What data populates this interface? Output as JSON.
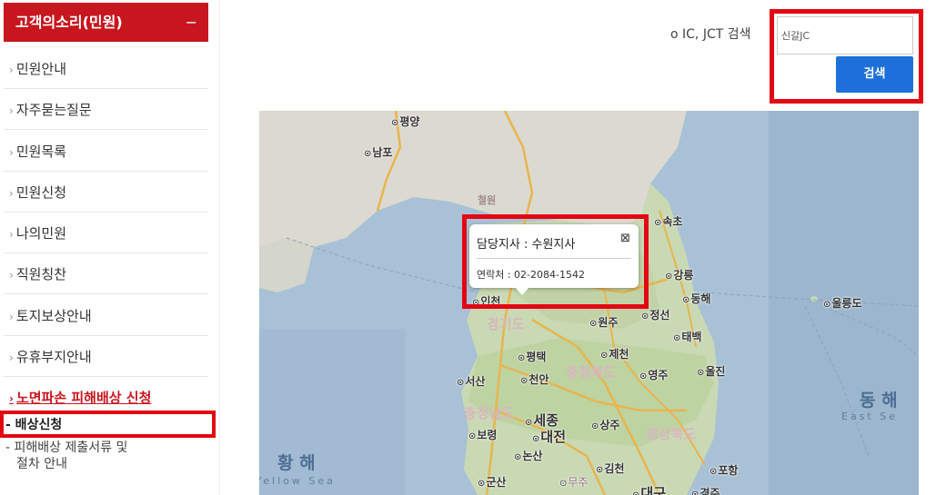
{
  "sidebar": {
    "header": "고객의소리(민원)",
    "header_toggle": "−",
    "arrow": "›",
    "items": [
      {
        "label": "민원안내"
      },
      {
        "label": "자주묻는질문"
      },
      {
        "label": "민원목록"
      },
      {
        "label": "민원신청"
      },
      {
        "label": "나의민원"
      },
      {
        "label": "직원칭찬"
      },
      {
        "label": "토지보상안내"
      },
      {
        "label": "유휴부지안내"
      },
      {
        "label": "노면파손 피해배상 신청",
        "active": true
      }
    ],
    "sub_items": [
      {
        "label": "- 배상신청",
        "selected": true
      },
      {
        "label": "- 피해배상 제출서류 및"
      },
      {
        "label": "절차 안내"
      }
    ]
  },
  "search": {
    "label": "o IC, JCT 검색",
    "value": "신갈JC",
    "button_label": "검색"
  },
  "map": {
    "popup": {
      "title": "담당지사 : 수원지사",
      "close_icon": "⊠",
      "phone": "연락처 : 02-2084-1542"
    },
    "places": [
      "평양",
      "남포",
      "속초",
      "강릉",
      "동해",
      "울릉도",
      "인천",
      "원주",
      "정선",
      "태백",
      "평택",
      "제천",
      "서산",
      "천안",
      "영주",
      "울진",
      "세종",
      "대전",
      "상주",
      "보령",
      "논산",
      "김천",
      "포항",
      "군산",
      "무주",
      "대구",
      "경주"
    ],
    "regions": [
      "철원",
      "경기도",
      "충청북도",
      "충청남도",
      "경상북도"
    ],
    "seas": {
      "yellow_ko": "황 해",
      "yellow_en": "Yellow Sea",
      "east_ko": "동 해",
      "east_en": "East Se"
    }
  },
  "colors": {
    "brand_red": "#c8161e",
    "highlight_red": "#e30613",
    "button_blue": "#1e6fd9"
  }
}
